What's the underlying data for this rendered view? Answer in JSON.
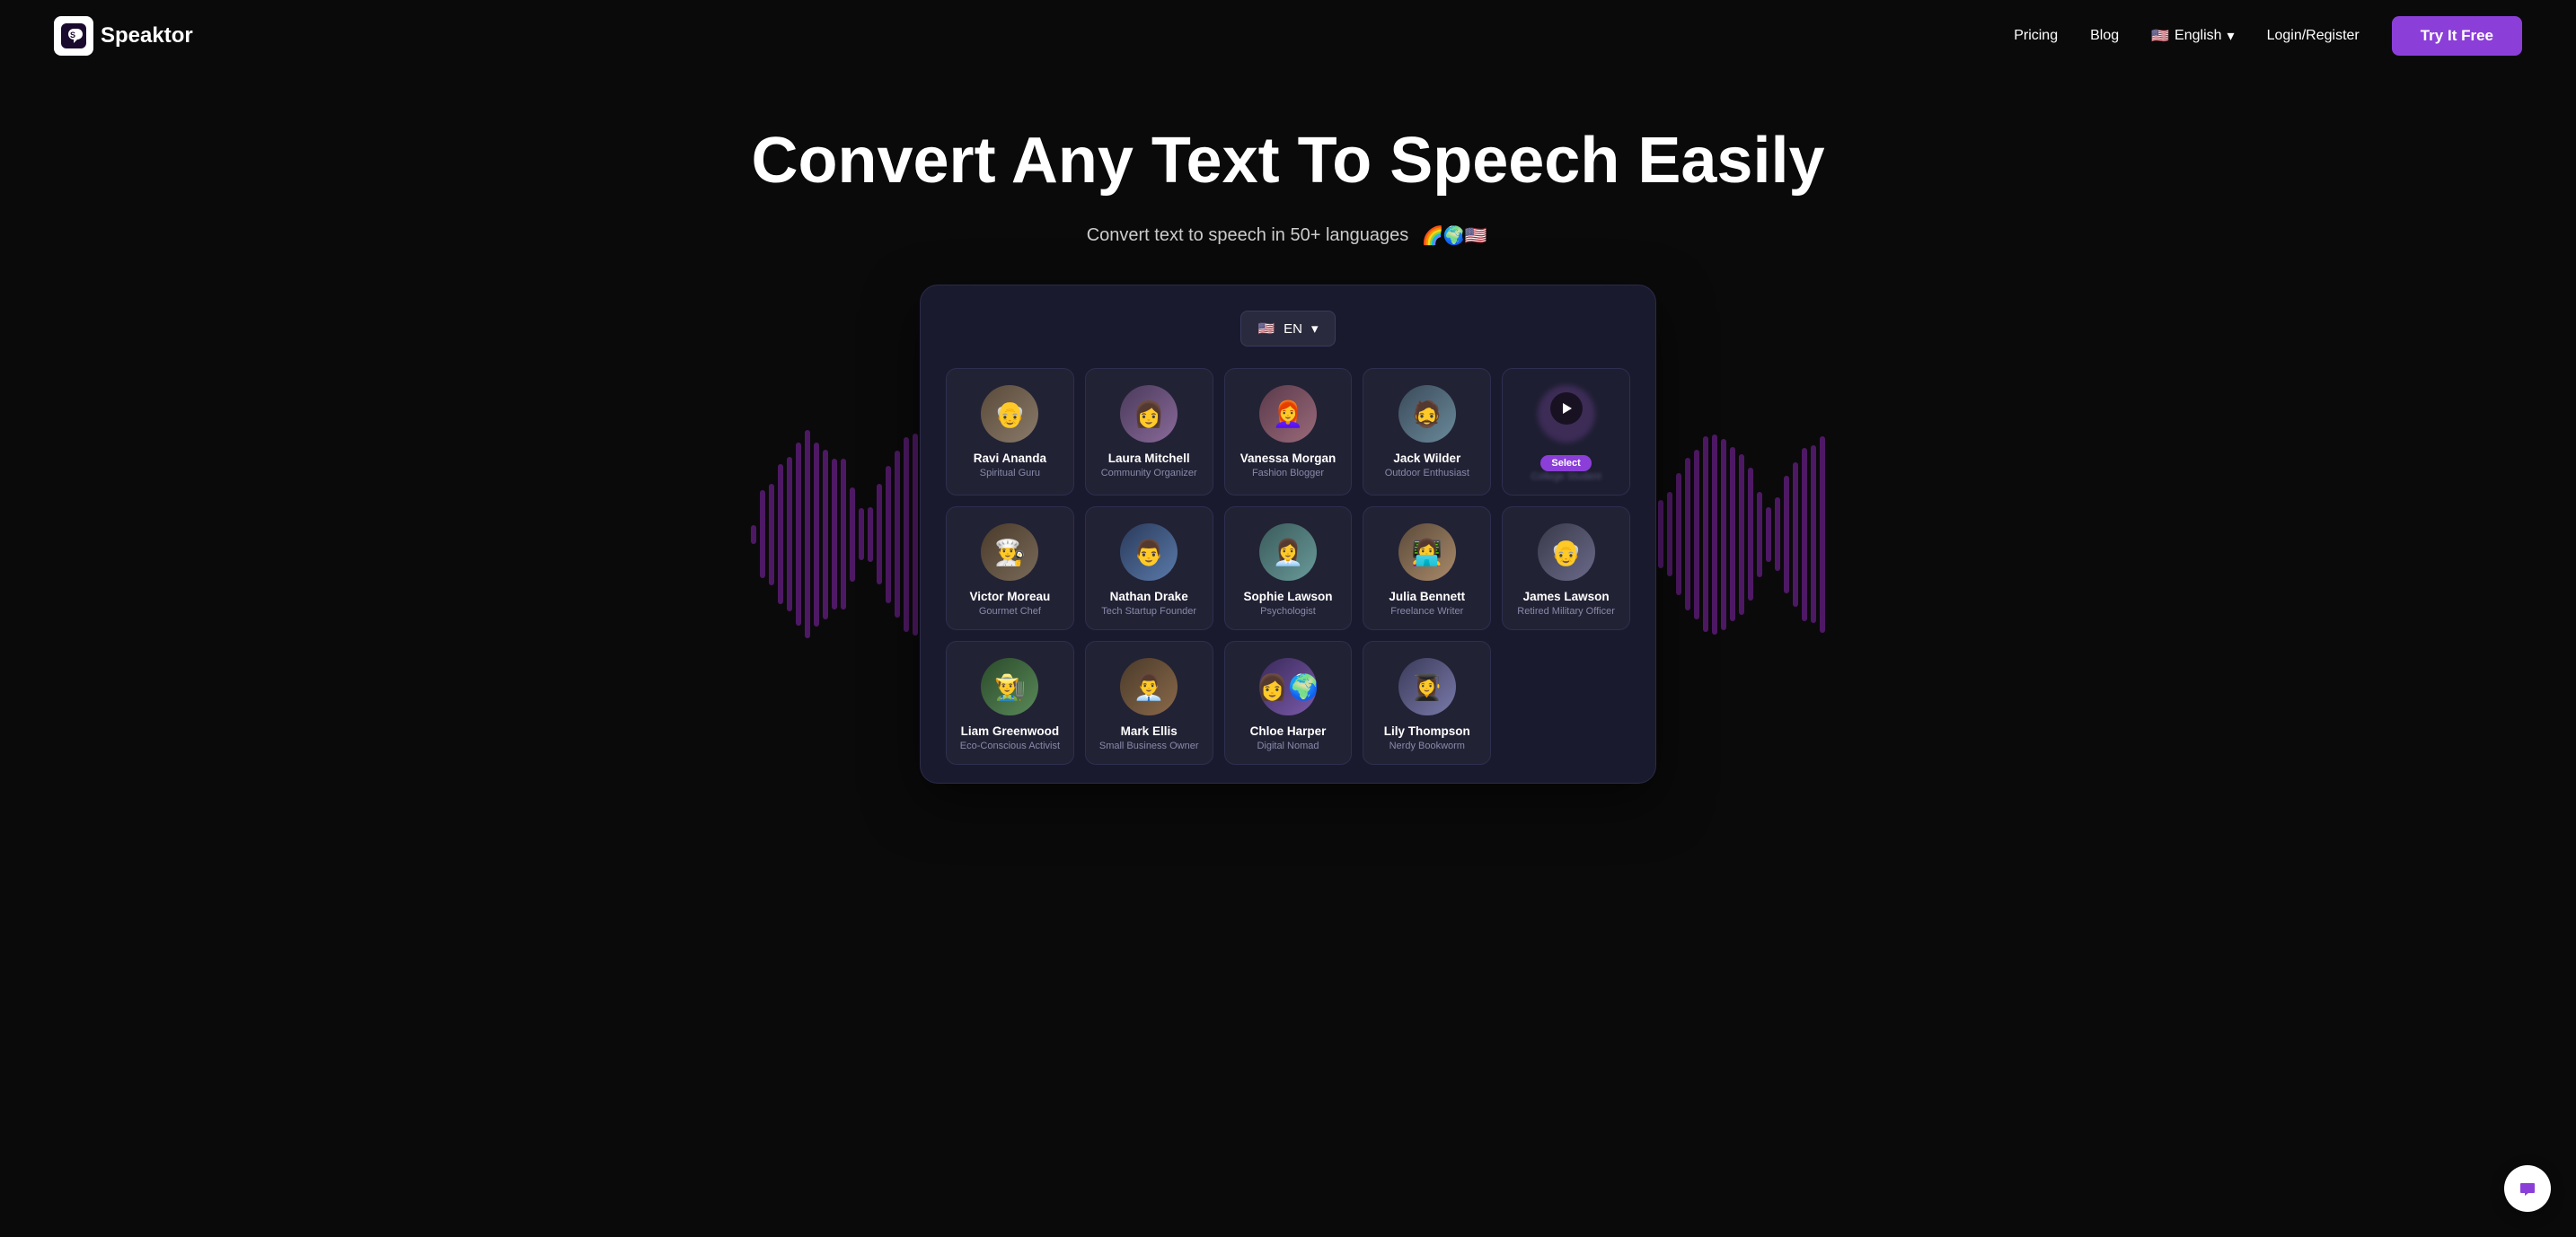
{
  "nav": {
    "logo_text": "Speaktor",
    "links": [
      "Pricing",
      "Blog"
    ],
    "language": "English",
    "auth": "Login/Register",
    "cta": "Try It Free"
  },
  "hero": {
    "title": "Convert Any Text To Speech Easily",
    "subtitle": "Convert text to speech in 50+ languages",
    "flags": [
      "🌈",
      "🌍",
      "🇺🇸"
    ]
  },
  "panel": {
    "lang_code": "EN",
    "voices_row1": [
      {
        "name": "Ravi Ananda",
        "role": "Spiritual Guru",
        "emoji": "👴"
      },
      {
        "name": "Laura Mitchell",
        "role": "Community Organizer",
        "emoji": "👩"
      },
      {
        "name": "Vanessa Morgan",
        "role": "Fashion Blogger",
        "emoji": "👩"
      },
      {
        "name": "Jack Wilder",
        "role": "Outdoor Enthusiast",
        "emoji": "👨"
      },
      {
        "name": "College Student",
        "role": "Select",
        "special": true
      }
    ],
    "voices_row2": [
      {
        "name": "Victor Moreau",
        "role": "Gourmet Chef",
        "emoji": "👨"
      },
      {
        "name": "Nathan Drake",
        "role": "Tech Startup Founder",
        "emoji": "👨"
      },
      {
        "name": "Sophie Lawson",
        "role": "Psychologist",
        "emoji": "👩"
      },
      {
        "name": "Julia Bennett",
        "role": "Freelance Writer",
        "emoji": "👩"
      },
      {
        "name": "James Lawson",
        "role": "Retired Military Officer",
        "emoji": "👨"
      }
    ],
    "voices_row3": [
      {
        "name": "Liam Greenwood",
        "role": "Eco-Conscious Activist",
        "emoji": "👨"
      },
      {
        "name": "Mark Ellis",
        "role": "Small Business Owner",
        "emoji": "👨"
      },
      {
        "name": "Chloe Harper",
        "role": "Digital Nomad",
        "emoji": "👩"
      },
      {
        "name": "Lily Thompson",
        "role": "Nerdy Bookworm",
        "emoji": "👩"
      }
    ]
  },
  "chat": {
    "icon": "💬"
  }
}
